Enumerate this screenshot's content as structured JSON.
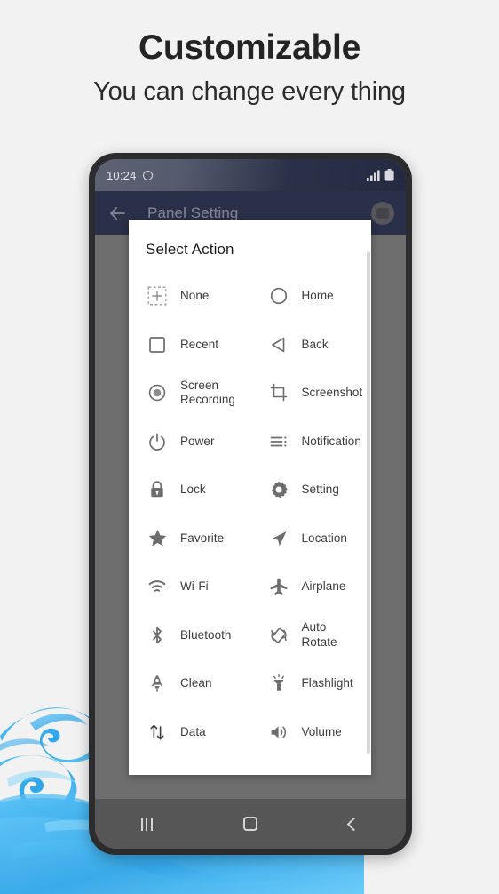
{
  "promo": {
    "title": "Customizable",
    "subtitle": "You can change every thing"
  },
  "phone": {
    "statusbar": {
      "time": "10:24",
      "camera_icon": "camera-cutout-icon",
      "signal_icon": "signal-bars-icon",
      "battery_icon": "battery-icon"
    },
    "appbar": {
      "back_icon": "back-arrow-icon",
      "title": "Panel Setting",
      "avatar_icon": "app-avatar-icon"
    },
    "navbar": {
      "recents_icon": "recents-icon",
      "home_icon": "home-icon",
      "back_icon": "back-chevron-icon"
    }
  },
  "dialog": {
    "title": "Select Action",
    "actions": [
      {
        "label": "None",
        "icon": "none-plus-icon"
      },
      {
        "label": "Home",
        "icon": "home-circle-icon"
      },
      {
        "label": "Recent",
        "icon": "recent-square-icon"
      },
      {
        "label": "Back",
        "icon": "back-triangle-icon"
      },
      {
        "label": "Screen\nRecording",
        "icon": "screen-recording-icon"
      },
      {
        "label": "Screenshot",
        "icon": "screenshot-crop-icon"
      },
      {
        "label": "Power",
        "icon": "power-icon"
      },
      {
        "label": "Notification",
        "icon": "notification-lines-icon"
      },
      {
        "label": "Lock",
        "icon": "lock-icon"
      },
      {
        "label": "Setting",
        "icon": "gear-icon"
      },
      {
        "label": "Favorite",
        "icon": "star-icon"
      },
      {
        "label": "Location",
        "icon": "location-arrow-icon"
      },
      {
        "label": "Wi-Fi",
        "icon": "wifi-icon"
      },
      {
        "label": "Airplane",
        "icon": "airplane-icon"
      },
      {
        "label": "Bluetooth",
        "icon": "bluetooth-icon"
      },
      {
        "label": "Auto\nRotate",
        "icon": "auto-rotate-icon"
      },
      {
        "label": "Clean",
        "icon": "clean-rocket-icon"
      },
      {
        "label": "Flashlight",
        "icon": "flashlight-icon"
      },
      {
        "label": "Data",
        "icon": "data-arrows-icon"
      },
      {
        "label": "Volume",
        "icon": "volume-icon"
      }
    ]
  },
  "colors": {
    "page_background": "#f2f2f2",
    "ink_blue": "#2fa8ef",
    "appbar_navy": "#2a3049",
    "scrim_gray": "#6e6e6e",
    "dialog_white": "#ffffff",
    "icon_gray": "#6d6d6d"
  }
}
